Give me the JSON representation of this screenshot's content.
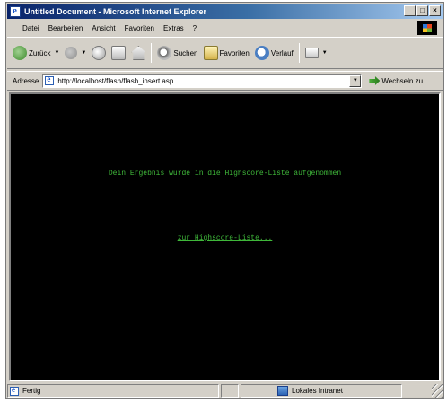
{
  "window": {
    "title": "Untitled Document - Microsoft Internet Explorer",
    "controls": [
      "_",
      "□",
      "×"
    ]
  },
  "menu": [
    "Datei",
    "Bearbeiten",
    "Ansicht",
    "Favoriten",
    "Extras",
    "?"
  ],
  "toolbar": {
    "back_label": "Zurück",
    "search_label": "Suchen",
    "favorites_label": "Favoriten",
    "history_label": "Verlauf"
  },
  "address": {
    "label": "Adresse",
    "url": "http://localhost/flash/flash_insert.asp",
    "go_label": "Wechseln zu"
  },
  "content": {
    "message": "Dein Ergebnis wurde in die Highscore-Liste aufgenommen",
    "link": "zur Highscore-Liste..."
  },
  "status": {
    "text": "Fertig",
    "zone": "Lokales Intranet"
  },
  "colors": {
    "content_bg": "#000000",
    "content_text": "#3fb83a",
    "titlebar_start": "#0a246a",
    "titlebar_end": "#a6caf0"
  }
}
